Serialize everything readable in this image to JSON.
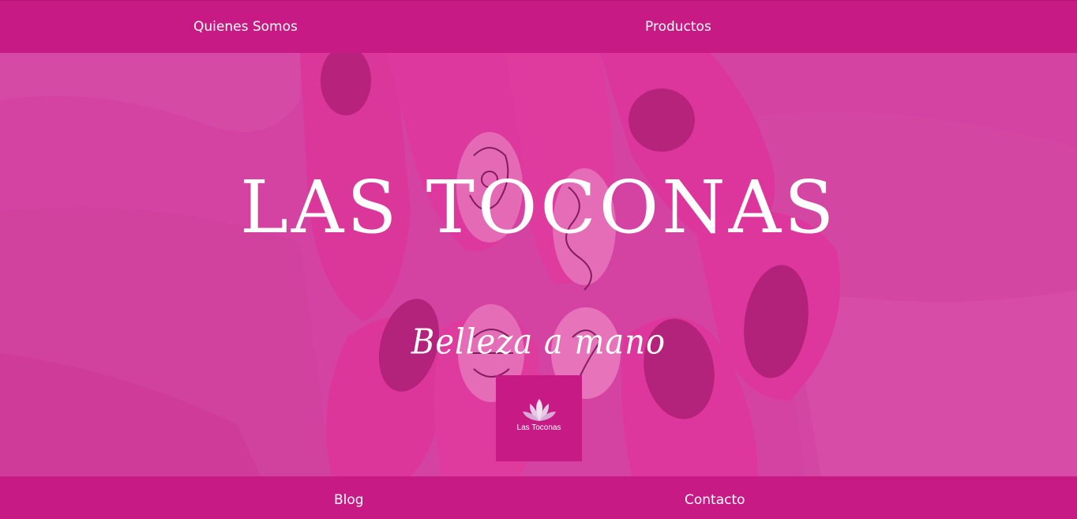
{
  "nav_top": {
    "items": [
      {
        "label": "Quienes Somos"
      },
      {
        "label": "Productos"
      }
    ]
  },
  "hero": {
    "title": "LAS TOCONAS",
    "subtitle": "Belleza a mano",
    "logo_text": "Las Toconas"
  },
  "nav_bottom": {
    "items": [
      {
        "label": "Blog"
      },
      {
        "label": "Contacto"
      }
    ]
  },
  "colors": {
    "brand_magenta": "#c71a84",
    "hero_overlay": "#d845a4",
    "text": "#ffffff"
  }
}
